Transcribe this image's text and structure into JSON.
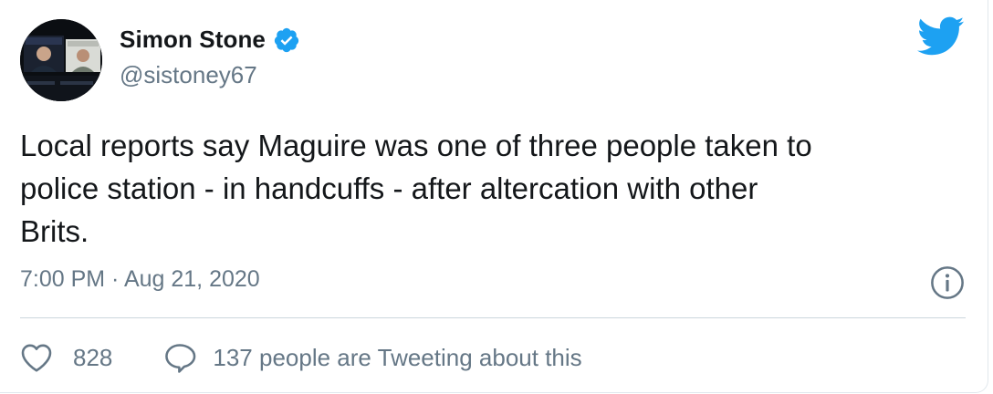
{
  "author": {
    "display_name": "Simon Stone",
    "handle": "@sistoney67",
    "verified": true,
    "avatar_icon": "video-call-avatar"
  },
  "brand": {
    "icon": "twitter-bird-icon",
    "color": "#1da1f2"
  },
  "tweet": {
    "text": "Local reports say Maguire was one of three people taken to\npolice station - in handcuffs - after altercation with other\nBrits.",
    "timestamp": "7:00 PM · Aug 21, 2020"
  },
  "engagement": {
    "likes": "828",
    "tweeting_text": "137 people are Tweeting about this"
  },
  "colors": {
    "text_primary": "#14171a",
    "text_secondary": "#657786",
    "divider": "#ccd6dd",
    "verified": "#1da1f2"
  }
}
